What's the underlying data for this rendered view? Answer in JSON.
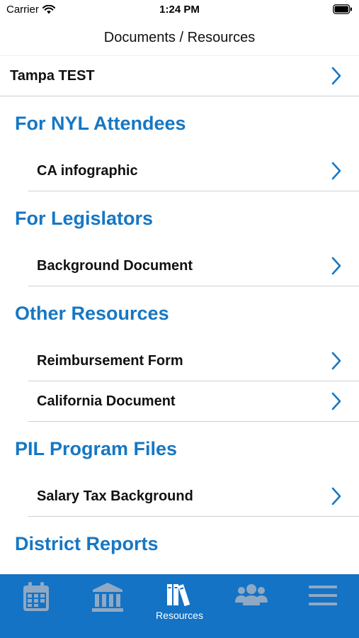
{
  "status": {
    "carrier": "Carrier",
    "time": "1:24 PM"
  },
  "nav": {
    "title": "Documents / Resources"
  },
  "top_item": {
    "label": "Tampa TEST"
  },
  "sections": [
    {
      "title": "For NYL Attendees",
      "items": [
        "CA infographic"
      ]
    },
    {
      "title": "For Legislators",
      "items": [
        "Background Document"
      ]
    },
    {
      "title": "Other Resources",
      "items": [
        "Reimbursement Form",
        "California Document"
      ]
    },
    {
      "title": "PIL Program Files",
      "items": [
        "Salary Tax Background"
      ]
    },
    {
      "title": "District Reports",
      "items": []
    }
  ],
  "tabs": [
    {
      "icon": "calendar-icon",
      "label": ""
    },
    {
      "icon": "capitol-building-icon",
      "label": ""
    },
    {
      "icon": "books-icon",
      "label": "Resources",
      "selected": true
    },
    {
      "icon": "people-icon",
      "label": ""
    },
    {
      "icon": "menu-icon",
      "label": ""
    }
  ],
  "colors": {
    "accent": "#1677c4",
    "tab_bar": "#1473c5",
    "tab_icon_inactive": "#8fa9c4",
    "tab_icon_active": "#ffffff",
    "chevron": "#1677c4"
  }
}
